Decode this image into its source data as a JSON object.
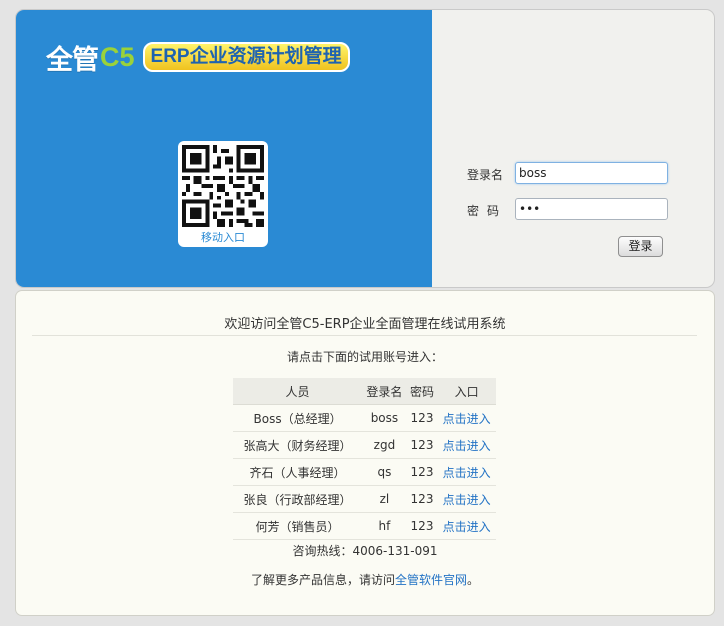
{
  "brand": {
    "logo_main": "全管",
    "logo_c5": "C5",
    "logo_tagline": "ERP企业资源计划管理",
    "qr_caption": "移动入口"
  },
  "login": {
    "username_label": "登录名",
    "username_value": "boss",
    "password_label": "密码",
    "password_value": "•••",
    "submit_label": "登录"
  },
  "info": {
    "welcome": "欢迎访问全管C5-ERP企业全面管理在线试用系统",
    "instruction": "请点击下面的试用账号进入：",
    "table_headers": [
      "人员",
      "登录名",
      "密码",
      "入口"
    ],
    "accounts": [
      {
        "person": "Boss（总经理）",
        "login": "boss",
        "password": "123",
        "entry": "点击进入"
      },
      {
        "person": "张高大（财务经理）",
        "login": "zgd",
        "password": "123",
        "entry": "点击进入"
      },
      {
        "person": "齐石（人事经理）",
        "login": "qs",
        "password": "123",
        "entry": "点击进入"
      },
      {
        "person": "张良（行政部经理）",
        "login": "zl",
        "password": "123",
        "entry": "点击进入"
      },
      {
        "person": "何芳（销售员）",
        "login": "hf",
        "password": "123",
        "entry": "点击进入"
      }
    ],
    "hotline": "咨询热线：4006-131-091",
    "more_prefix": "了解更多产品信息，请访问",
    "more_link": "全管软件官网",
    "more_suffix": "。"
  },
  "colors": {
    "brand_blue": "#2a8ad4",
    "logo_green": "#9ad23a",
    "tagline_yellow": "#f5d83a",
    "link_blue": "#2373c5"
  }
}
